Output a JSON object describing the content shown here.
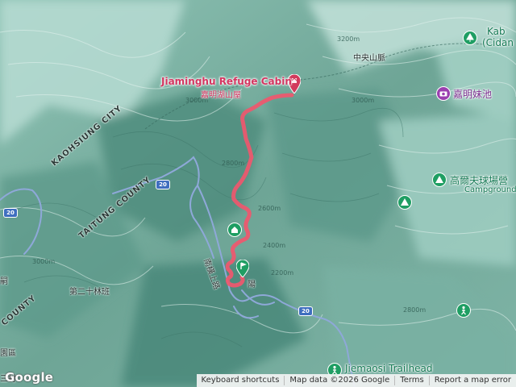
{
  "map": {
    "google_logo": "Google",
    "attribution": {
      "shortcuts": "Keyboard shortcuts",
      "map_data": "Map data ©2026 Google",
      "terms": "Terms",
      "report": "Report a map error"
    },
    "markers": {
      "destination": {
        "title": "Jiaminghu Refuge Cabin",
        "subtitle": "嘉明湖山屋",
        "icon": "red-pin-icon",
        "color": "#d23a5c"
      },
      "start": {
        "icon": "green-flag-pin-icon",
        "color": "#1f9e63",
        "label": "陽"
      },
      "cabin_on_route": {
        "icon": "green-cabin-icon",
        "color": "#1f9e63"
      }
    },
    "pois": {
      "top_right_cut": "Kab",
      "top_right_cut2": "(Cidan",
      "jiaming_sister_lake": "嘉明妹池",
      "gaolifu_camp": "高爾夫球場營",
      "campground": "Campground",
      "jiemaosi": "Jiemaosi Trailhead"
    },
    "regions": {
      "central_range": "中央山脈",
      "kaohsiung": "KAOHSIUNG CITY",
      "taitung": "TAITUNG COUNTY",
      "forest_zone": "第二十林班",
      "county_cut": "COUNTY",
      "trail_name": "南橫上路",
      "cut_left_top": "嗣",
      "cut_left_bottom": "園區",
      "cut_left_bottom2": "三村"
    },
    "roads": [
      {
        "label": "20"
      },
      {
        "label": "20"
      },
      {
        "label": "20"
      }
    ],
    "contours": [
      "3200m",
      "3000m",
      "2800m",
      "2600m",
      "2400m",
      "2200m",
      "3000m",
      "2800m",
      "3000m"
    ],
    "colors": {
      "route": "#f0576e",
      "river": "#8ea8d8",
      "terrain_dark": "#4e8f80",
      "terrain_light": "#d7ebe5"
    }
  }
}
